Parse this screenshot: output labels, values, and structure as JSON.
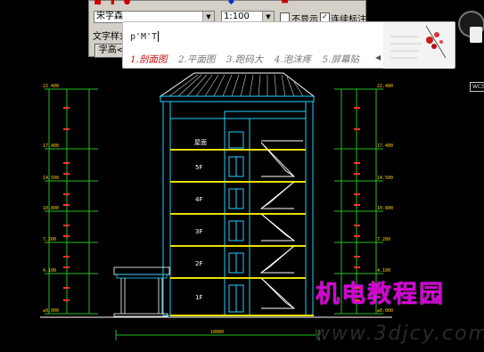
{
  "toolbar": {
    "font_name": "宋字森",
    "scale": "1:100",
    "hide_label": "不显示",
    "continuous_label": "连续标注",
    "hide_checked": false,
    "continuous_checked": true,
    "text_style_label": "文字样式",
    "text_height_button": "字高<"
  },
  "ime": {
    "input": "p'M'T",
    "candidates": [
      "1.剖面图",
      "2.平面图",
      "3.跑码大",
      "4.泡沫疼",
      "5.屏幕贴"
    ],
    "selected_index": 0
  },
  "drawing": {
    "floors": [
      "1F",
      "2F",
      "3F",
      "4F",
      "5F"
    ],
    "roof_label": "屋面",
    "bottom_dimension": "18000",
    "left_elevations": [
      "22.400",
      "17.400",
      "14.500",
      "10.800",
      "7.200",
      "4.100",
      "±0.000"
    ],
    "right_elevations": [
      "22.400",
      "17.400",
      "14.500",
      "10.800",
      "7.200",
      "4.100",
      "±0.000"
    ]
  },
  "overlay": {
    "wcs_label": "WCS",
    "watermark": "机电教程园",
    "watermark_url": "www.3djcy.com"
  },
  "colors": {
    "floor_slab": "#e8e000",
    "structure": "#22d0ff",
    "stairs": "#ffffff",
    "dimension_green": "#22c022",
    "elevation_red": "#ff3030",
    "watermark": "#d500d5",
    "ime_selected": "#c41010"
  }
}
